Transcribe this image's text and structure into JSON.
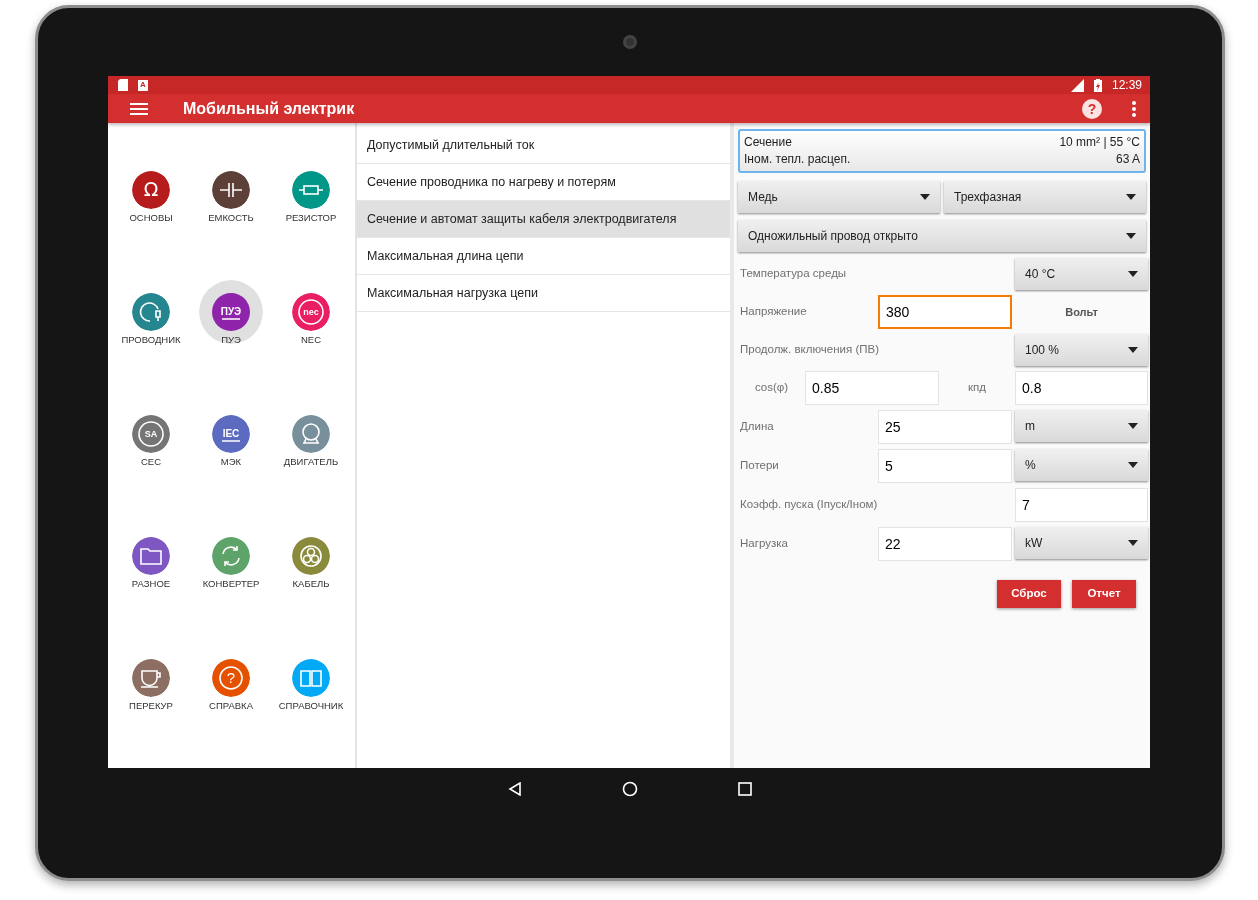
{
  "status_bar": {
    "notification_glyph": "A",
    "time": "12:39"
  },
  "app_bar": {
    "title": "Мобильный электрик",
    "help_glyph": "?"
  },
  "tools": [
    {
      "label": "ОСНОВЫ",
      "kind": "omega",
      "glyph": "Ω",
      "color": "#b71c1c",
      "selected": false
    },
    {
      "label": "ЕМКОСТЬ",
      "kind": "capacitor",
      "color": "#5d4037",
      "selected": false
    },
    {
      "label": "РЕЗИСТОР",
      "kind": "resistor",
      "color": "#009688",
      "selected": false
    },
    {
      "label": "ПРОВОДНИК",
      "kind": "cord",
      "color": "#26868f",
      "selected": false
    },
    {
      "label": "ПУЭ",
      "kind": "badge",
      "glyph": "ПУЭ",
      "color": "#8e24aa",
      "selected": true
    },
    {
      "label": "NEC",
      "kind": "ring",
      "glyph": "nec",
      "color": "#e91e63",
      "selected": false
    },
    {
      "label": "CEC",
      "kind": "ring",
      "glyph": "SA",
      "color": "#757575",
      "selected": false
    },
    {
      "label": "МЭК",
      "kind": "badge",
      "glyph": "IEC",
      "color": "#5c6bc0",
      "selected": false
    },
    {
      "label": "ДВИГАТЕЛЬ",
      "kind": "motor",
      "color": "#78909c",
      "selected": false
    },
    {
      "label": "РАЗНОЕ",
      "kind": "folder",
      "color": "#7e57c2",
      "selected": false
    },
    {
      "label": "КОНВЕРТЕР",
      "kind": "refresh",
      "color": "#5ea36a",
      "selected": false
    },
    {
      "label": "КАБЕЛЬ",
      "kind": "cable",
      "color": "#8a8a3c",
      "selected": false
    },
    {
      "label": "ПЕРЕКУР",
      "kind": "cup",
      "color": "#8d6e63",
      "selected": false
    },
    {
      "label": "СПРАВКА",
      "kind": "question",
      "glyph": "?",
      "color": "#e65100",
      "selected": false
    },
    {
      "label": "СПРАВОЧНИК",
      "kind": "book",
      "color": "#03a9f4",
      "selected": false
    }
  ],
  "calculations": [
    {
      "label": "Допустимый длительный ток",
      "selected": false
    },
    {
      "label": "Сечение проводника по нагреву и потерям",
      "selected": false
    },
    {
      "label": "Сечение и автомат защиты кабеля электродвигателя",
      "selected": true
    },
    {
      "label": "Максимальная длина цепи",
      "selected": false
    },
    {
      "label": "Максимальная нагрузка цепи",
      "selected": false
    }
  ],
  "result": [
    {
      "label": "Сечение",
      "value": "10 mm² | 55 °C"
    },
    {
      "label": "Iном. тепл. расцеп.",
      "value": "63 A"
    }
  ],
  "material": "Медь",
  "phase": "Трехфазная",
  "installation": "Одножильный провод открыто",
  "fields": [
    {
      "kind": "select",
      "label": "Температура среды",
      "select": "40 °C"
    },
    {
      "kind": "input-unit",
      "label": "Напряжение",
      "value": "380",
      "focused": true,
      "unit": "Вольт"
    },
    {
      "kind": "select",
      "label": "Продолж. включения (ПВ)",
      "select": "100 %"
    },
    {
      "kind": "pair",
      "label": "cos(φ)",
      "value": "0.85",
      "label2": "кпд",
      "value2": "0.8"
    },
    {
      "kind": "input-select",
      "label": "Длина",
      "value": "25",
      "focused": false,
      "select": "m"
    },
    {
      "kind": "input-select",
      "label": "Потери",
      "value": "5",
      "focused": false,
      "select": "%"
    },
    {
      "kind": "input-right",
      "label": "Коэфф. пуска (Iпуск/Iном)",
      "value": "7"
    },
    {
      "kind": "input-select",
      "label": "Нагрузка",
      "value": "22",
      "focused": false,
      "select": "kW"
    }
  ],
  "buttons": [
    "Сброс",
    "Отчет"
  ]
}
